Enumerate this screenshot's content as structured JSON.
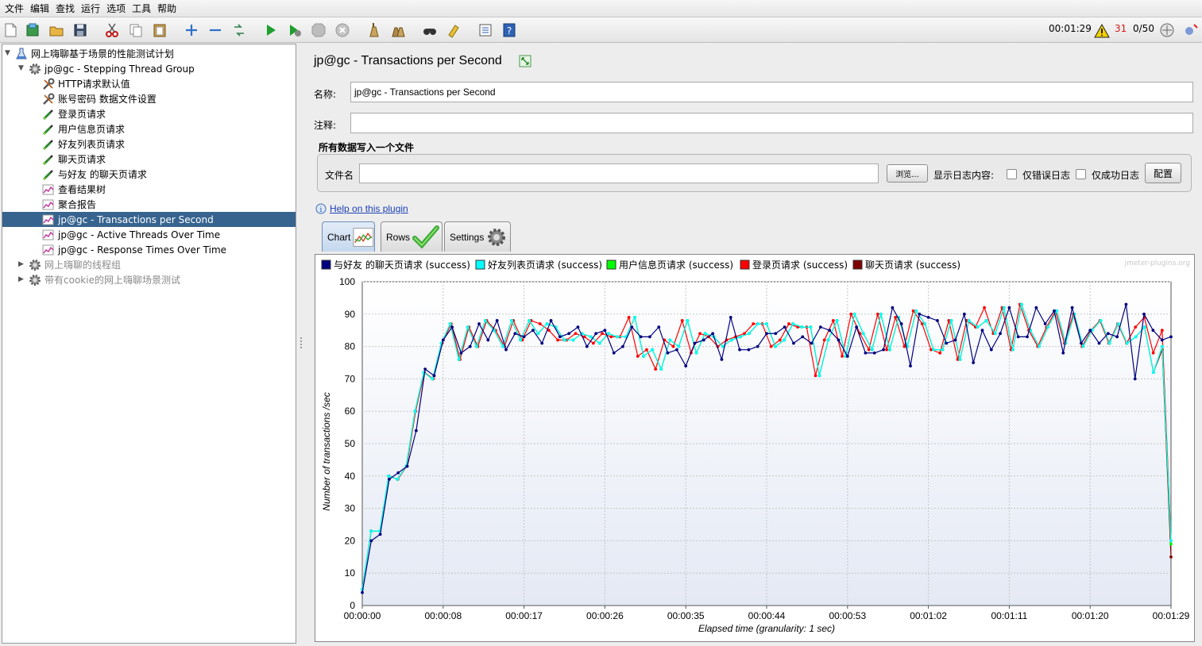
{
  "menu": [
    "文件",
    "编辑",
    "查找",
    "运行",
    "选项",
    "工具",
    "帮助"
  ],
  "toolbar": {
    "icons": [
      "new-icon",
      "templates-icon",
      "open-icon",
      "save-icon",
      "cut-icon",
      "copy-icon",
      "paste-icon",
      "add-icon",
      "remove-icon",
      "toggle-icon",
      "start-icon",
      "start-no-pause-icon",
      "stop-icon",
      "shutdown-icon",
      "clear-icon",
      "clear-all-icon",
      "search-icon",
      "reset-search-icon",
      "function-helper-icon",
      "help-icon"
    ],
    "elapsed": "00:01:29",
    "warnings": "31",
    "threads": "0/50"
  },
  "tree": {
    "items": [
      {
        "label": "网上嗨聊基于场景的性能测试计划",
        "icon": "test-plan-icon",
        "level": 0,
        "expanded": true
      },
      {
        "label": "jp@gc - Stepping Thread Group",
        "icon": "thread-group-icon",
        "level": 1,
        "expanded": true
      },
      {
        "label": "HTTP请求默认值",
        "icon": "config-wrench-icon",
        "level": 2
      },
      {
        "label": "账号密码 数据文件设置",
        "icon": "config-wrench-icon",
        "level": 2
      },
      {
        "label": "登录页请求",
        "icon": "sampler-pipette-icon",
        "level": 2
      },
      {
        "label": "用户信息页请求",
        "icon": "sampler-pipette-icon",
        "level": 2
      },
      {
        "label": "好友列表页请求",
        "icon": "sampler-pipette-icon",
        "level": 2
      },
      {
        "label": "聊天页请求",
        "icon": "sampler-pipette-icon",
        "level": 2
      },
      {
        "label": "与好友 的聊天页请求",
        "icon": "sampler-pipette-icon",
        "level": 2
      },
      {
        "label": "查看结果树",
        "icon": "listener-graph-icon",
        "level": 2
      },
      {
        "label": "聚合报告",
        "icon": "listener-graph-icon",
        "level": 2
      },
      {
        "label": "jp@gc - Transactions per Second",
        "icon": "listener-graph-icon",
        "level": 2,
        "selected": true
      },
      {
        "label": "jp@gc - Active Threads Over Time",
        "icon": "listener-graph-icon",
        "level": 2
      },
      {
        "label": "jp@gc - Response Times Over Time",
        "icon": "listener-graph-icon",
        "level": 2
      },
      {
        "label": "网上嗨聊的线程组",
        "icon": "thread-group-icon",
        "level": 1,
        "disabled": true,
        "collapsed": true
      },
      {
        "label": "带有cookie的网上嗨聊场景测试",
        "icon": "thread-group-icon",
        "level": 1,
        "disabled": true,
        "collapsed": true
      }
    ]
  },
  "panel": {
    "title": "jp@gc - Transactions per Second",
    "name_label": "名称:",
    "name_value": "jp@gc - Transactions per Second",
    "comment_label": "注释:",
    "comment_value": "",
    "file_group_title": "所有数据写入一个文件",
    "filename_label": "文件名",
    "filename_value": "",
    "browse_label": "浏览...",
    "log_label": "显示日志内容:",
    "errors_only_label": "仅错误日志",
    "success_only_label": "仅成功日志",
    "configure_label": "配置",
    "help_link": "Help on this plugin",
    "tabs": [
      {
        "label": "Chart",
        "icon": "chart-icon",
        "active": true
      },
      {
        "label": "Rows",
        "icon": "checkmark-icon"
      },
      {
        "label": "Settings",
        "icon": "gear-icon"
      }
    ]
  },
  "chart_data": {
    "type": "line",
    "watermark": "jmeter-plugins.org",
    "xlabel": "Elapsed time (granularity: 1 sec)",
    "ylabel": "Number of transactions /sec",
    "ylim": [
      0,
      100
    ],
    "yticks": [
      0,
      10,
      20,
      30,
      40,
      50,
      60,
      70,
      80,
      90,
      100
    ],
    "xlim": [
      0,
      89
    ],
    "xticks": [
      "00:00:00",
      "00:00:08",
      "00:00:17",
      "00:00:26",
      "00:00:35",
      "00:00:44",
      "00:00:53",
      "00:01:02",
      "00:01:11",
      "00:01:20",
      "00:01:29"
    ],
    "grid": true,
    "legend_position": "top",
    "series": [
      {
        "name": "与好友 的聊天页请求 (success)",
        "color": "#000080",
        "values": [
          4,
          20,
          22,
          39,
          41,
          43,
          54,
          73,
          71,
          82,
          86,
          78,
          80,
          87,
          82,
          88,
          79,
          84,
          83,
          85,
          81,
          88,
          83,
          84,
          86,
          80,
          84,
          85,
          78,
          80,
          86,
          83,
          83,
          86,
          78,
          79,
          74,
          81,
          82,
          84,
          76,
          89,
          79,
          79,
          80,
          84,
          84,
          86,
          81,
          83,
          81,
          86,
          85,
          82,
          77,
          86,
          78,
          78,
          79,
          92,
          87,
          74,
          90,
          89,
          88,
          81,
          82,
          90,
          75,
          85,
          79,
          84,
          92,
          83,
          83,
          92,
          87,
          91,
          78,
          92,
          81,
          85,
          81,
          84,
          83,
          93,
          70,
          90,
          85,
          82,
          83
        ]
      },
      {
        "name": "好友列表页请求 (success)",
        "color": "#00ffff",
        "values": [
          5,
          23,
          23,
          40,
          39,
          43,
          60,
          72,
          70,
          81,
          87,
          76,
          86,
          80,
          88,
          85,
          80,
          88,
          82,
          88,
          84,
          87,
          86,
          82,
          82,
          84,
          83,
          81,
          84,
          83,
          83,
          89,
          77,
          79,
          73,
          82,
          80,
          88,
          78,
          84,
          83,
          80,
          82,
          83,
          84,
          87,
          87,
          80,
          82,
          87,
          86,
          86,
          71,
          82,
          88,
          77,
          90,
          84,
          79,
          90,
          79,
          89,
          80,
          91,
          87,
          79,
          79,
          88,
          76,
          88,
          86,
          88,
          84,
          92,
          79,
          93,
          85,
          80,
          86,
          91,
          81,
          90,
          80,
          85,
          88,
          81,
          87,
          81,
          83,
          86,
          72,
          80,
          20
        ]
      },
      {
        "name": "用户信息页请求 (success)",
        "color": "#00ff00",
        "values": [
          5,
          23,
          23,
          40,
          39,
          43,
          60,
          72,
          70,
          81,
          87,
          76,
          86,
          80,
          88,
          85,
          80,
          88,
          82,
          88,
          84,
          87,
          86,
          82,
          82,
          84,
          83,
          81,
          84,
          83,
          83,
          89,
          77,
          79,
          73,
          82,
          80,
          88,
          78,
          84,
          83,
          80,
          82,
          83,
          84,
          87,
          87,
          80,
          82,
          87,
          86,
          86,
          71,
          82,
          88,
          77,
          90,
          84,
          79,
          90,
          79,
          89,
          80,
          91,
          87,
          79,
          79,
          88,
          76,
          88,
          86,
          88,
          84,
          92,
          79,
          93,
          85,
          80,
          86,
          91,
          81,
          90,
          80,
          85,
          88,
          81,
          87,
          81,
          83,
          86,
          72,
          80,
          19
        ]
      },
      {
        "name": "登录页请求 (success)",
        "color": "#ff0000",
        "values": [
          5,
          23,
          23,
          40,
          39,
          43,
          60,
          72,
          70,
          81,
          87,
          76,
          86,
          80,
          88,
          85,
          80,
          88,
          82,
          88,
          87,
          85,
          82,
          82,
          84,
          83,
          81,
          84,
          83,
          83,
          89,
          77,
          79,
          73,
          82,
          80,
          88,
          78,
          84,
          83,
          80,
          82,
          83,
          84,
          87,
          87,
          80,
          82,
          87,
          86,
          86,
          71,
          82,
          88,
          77,
          90,
          84,
          79,
          90,
          79,
          89,
          80,
          91,
          87,
          79,
          78,
          88,
          76,
          88,
          86,
          92,
          84,
          92,
          79,
          93,
          85,
          80,
          86,
          91,
          81,
          90,
          80,
          85,
          88,
          81,
          87,
          81,
          86,
          89,
          78,
          85,
          20
        ]
      },
      {
        "name": "聊天页请求 (success)",
        "color": "#800000",
        "values": [
          5,
          23,
          23,
          40,
          39,
          43,
          60,
          72,
          70,
          81,
          87,
          76,
          86,
          80,
          88,
          85,
          80,
          88,
          82,
          88,
          84,
          87,
          86,
          82,
          82,
          84,
          83,
          81,
          84,
          83,
          83,
          89,
          77,
          79,
          73,
          82,
          80,
          88,
          78,
          84,
          83,
          80,
          82,
          83,
          84,
          87,
          87,
          80,
          82,
          87,
          86,
          86,
          71,
          82,
          88,
          77,
          90,
          84,
          79,
          90,
          79,
          89,
          80,
          91,
          87,
          79,
          79,
          88,
          76,
          88,
          86,
          88,
          84,
          92,
          79,
          93,
          85,
          80,
          86,
          91,
          81,
          90,
          80,
          85,
          88,
          81,
          87,
          81,
          83,
          86,
          72,
          79,
          15
        ]
      }
    ]
  }
}
